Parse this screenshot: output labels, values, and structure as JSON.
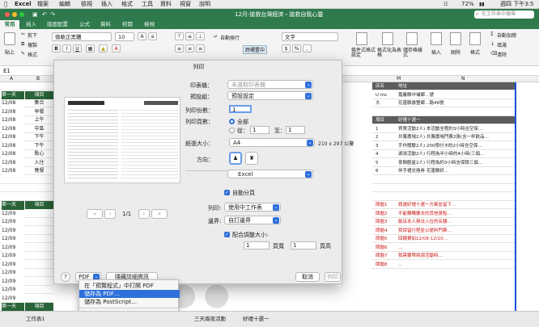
{
  "menubar": {
    "apple_icon": "apple-icon",
    "app": "Excel",
    "items": [
      "檔案",
      "編輯",
      "檢視",
      "插入",
      "格式",
      "工具",
      "資料",
      "視窗",
      "說明"
    ],
    "status": {
      "battery": "72%",
      "day": "週四 下午3:5"
    }
  },
  "window": {
    "title": "12月-搶救台灣經濟・搶救自我心靈",
    "search_placeholder": "在工作表中搜尋"
  },
  "ribbon": {
    "tabs": [
      "常用",
      "插入",
      "版面配置",
      "公式",
      "資料",
      "校閱",
      "檢視"
    ],
    "paste_label": "貼上",
    "cut_label": "剪下",
    "copy_label": "複製",
    "format_label": "格式",
    "font_name": "微軟正黑體",
    "font_size": "10",
    "wrap_label": "自動換行",
    "merge_label": "跨欄置中",
    "number_format": "文字",
    "cond_format": "條件式格式設定",
    "format_table": "格式化為表格",
    "cell_styles": "儲存格樣式",
    "insert_label": "插入",
    "delete_label": "刪除",
    "format_btn": "格式",
    "autosum_label": "自動加總",
    "fill_label": "填滿",
    "clear_label": "清除"
  },
  "formula_bar": {
    "cell_ref": "E1",
    "fx": "fx"
  },
  "columns": [
    "A",
    "B",
    "C",
    "D",
    "M",
    "N"
  ],
  "left_rows": [
    {
      "num": "1",
      "date": "",
      "group": ""
    },
    {
      "num": "2",
      "date": "第一天12/08",
      "group": "項目",
      "green": true
    },
    {
      "num": "3",
      "date": "12/08",
      "group": "集合"
    },
    {
      "num": "4",
      "date": "12/08",
      "group": "早餐"
    },
    {
      "num": "5",
      "date": "12/08",
      "group": "上午"
    },
    {
      "num": "6",
      "date": "12/08",
      "group": "中區"
    },
    {
      "num": "7",
      "date": "12/08",
      "group": "下午"
    },
    {
      "num": "8",
      "date": "12/08",
      "group": "下午"
    },
    {
      "num": "9",
      "date": "12/08",
      "group": "點心"
    },
    {
      "num": "10",
      "date": "12/08",
      "group": "入住"
    },
    {
      "num": "11",
      "date": "12/08",
      "group": "晚餐"
    },
    {
      "num": "12",
      "date": "",
      "group": ""
    },
    {
      "num": "13",
      "date": "",
      "group": ""
    },
    {
      "num": "14",
      "date": "",
      "group": ""
    },
    {
      "num": "15",
      "date": "第一天1209",
      "group": "項目",
      "green": true
    },
    {
      "num": "16",
      "date": "12/09",
      "group": ""
    },
    {
      "num": "17",
      "date": "12/09",
      "group": ""
    },
    {
      "num": "18",
      "date": "12/09",
      "group": ""
    },
    {
      "num": "19",
      "date": "12/09",
      "group": ""
    },
    {
      "num": "20",
      "date": "12/09",
      "group": ""
    },
    {
      "num": "21",
      "date": "12/09",
      "group": ""
    },
    {
      "num": "22",
      "date": "12/09",
      "group": ""
    },
    {
      "num": "23",
      "date": "12/09",
      "group": ""
    },
    {
      "num": "24",
      "date": "12/09",
      "group": ""
    },
    {
      "num": "25",
      "date": "12/09",
      "group": ""
    },
    {
      "num": "26",
      "date": "12/09",
      "group": ""
    },
    {
      "num": "27",
      "date": "第一天1210",
      "group": "項目",
      "green": true
    }
  ],
  "right_rows": [
    {
      "a": "店名",
      "b": "地址",
      "hdr": true
    },
    {
      "a": "U ms",
      "b": "嘉義縣中埔鄉…號"
    },
    {
      "a": "大",
      "b": "花蓮縣壽豐鄉…路46號"
    },
    {
      "a": "",
      "b": ""
    },
    {
      "a": "項目",
      "b": "好禮十選一",
      "hdr": true
    },
    {
      "a": "1",
      "b": "買賣活動2人) 本活動全程約3小時含空保…"
    },
    {
      "a": "2",
      "b": "共饗農場2人) 共饗農場門票2張(含一杯飲品…"
    },
    {
      "a": "3",
      "b": "手作體驗2人) 200預付卡約2小時含空保…"
    },
    {
      "a": "4",
      "b": "湖濱活動2人) 行程為半小時的4小時(三個…"
    },
    {
      "a": "5",
      "b": "夜間觀星2人) 行程為約3小時含保險三個…"
    },
    {
      "a": "6",
      "b": "伴手禮兌換券 花蓮縣好…"
    },
    {
      "a": "",
      "b": ""
    },
    {
      "a": "",
      "b": ""
    },
    {
      "a": "",
      "b": ""
    },
    {
      "a": "問題1",
      "b": "請選好禮十選一方案並留下…",
      "red": true
    },
    {
      "a": "問題2",
      "b": "不能轉購要去的其他景點…",
      "red": true
    },
    {
      "a": "問題3",
      "b": "飯店本人無法入住的名額…",
      "red": true
    },
    {
      "a": "問題4",
      "b": "我保留行程並以便利門票…",
      "red": true
    },
    {
      "a": "問題5",
      "b": "回饋費如12/08-12/10…",
      "red": true
    },
    {
      "a": "問題6",
      "b": "…",
      "red": true
    },
    {
      "a": "問題7",
      "b": "我需要帶兩週活動時…",
      "red": true
    },
    {
      "a": "問題8",
      "b": "…",
      "red": true
    }
  ],
  "print_dialog": {
    "title": "列印",
    "printer_label": "印表機：",
    "printer_value": "未選取印表機",
    "presets_label": "預設組：",
    "presets_value": "預設設定",
    "copies_label": "列印份數：",
    "copies_value": "1",
    "pages_label": "列印頁數：",
    "pages_all": "全部",
    "pages_from": "從：",
    "pages_from_value": "1",
    "pages_to": "至：",
    "pages_to_value": "1",
    "paper_label": "紙張大小：",
    "paper_value": "A4",
    "paper_dims": "210 x 297 公釐",
    "orientation_label": "方向：",
    "app_value": "Excel",
    "auto_paging": "自動分頁",
    "print_label": "列印:",
    "print_value": "使用中工作表",
    "margins_label": "邊界:",
    "margins_value": "自訂邊界",
    "fit_label": "配合調整大小:",
    "fit_wide_value": "1",
    "fit_wide": "頁寬",
    "fit_tall_value": "1",
    "fit_tall": "頁高",
    "page_indicator": "1/1",
    "help": "?",
    "pdf_button": "PDF",
    "hide_details": "隱藏詳細資訊",
    "cancel": "取消",
    "print": "列印"
  },
  "pdf_menu": [
    {
      "label": "在「預覽程式」中打開 PDF",
      "hl": false
    },
    {
      "label": "儲存為 PDF…",
      "hl": true
    },
    {
      "label": "儲存為 PostScript…",
      "hl": false
    },
    {
      "label": "",
      "sep": true
    },
    {
      "label": "將 PDF 加入 iBooks",
      "hl": false
    },
    {
      "label": "郵寄 PDF",
      "hl": false
    },
    {
      "label": "Save as Adobe PDF",
      "hl": false
    }
  ],
  "sheet_tabs": [
    "工作表1",
    "三天兩夜活動",
    "好禮十選一"
  ],
  "colors": {
    "accent": "#2e6fdb",
    "excel_green": "#2e7a4c",
    "dark_green": "#2a6339",
    "red": "#cc1a1a"
  }
}
